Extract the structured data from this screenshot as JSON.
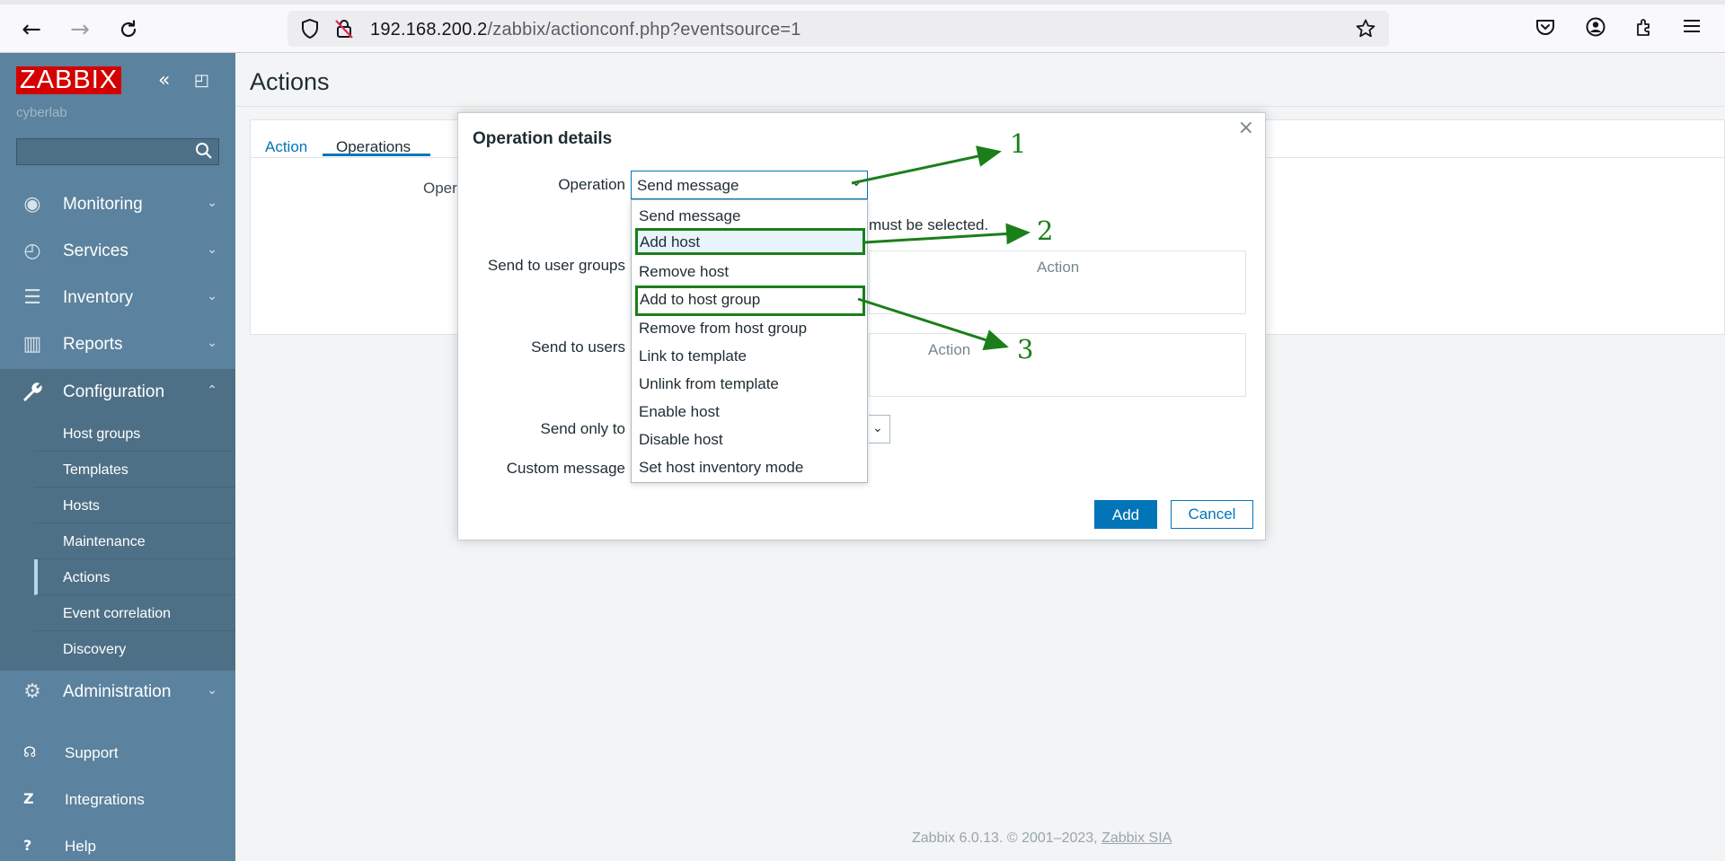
{
  "browser": {
    "url_host": "192.168.200.2",
    "url_path": "/zabbix/actionconf.php?eventsource=1",
    "back_glyph": "←",
    "forward_glyph": "→",
    "reload_glyph": "C",
    "icons": [
      "back-icon",
      "forward-icon",
      "reload-icon",
      "shield-icon",
      "insecure-lock-icon",
      "star-icon",
      "pocket-icon",
      "account-icon",
      "extensions-icon",
      "menu-icon"
    ]
  },
  "sidebar": {
    "logo": "ZABBIX",
    "tenant": "cyberlab",
    "collapse_glyph": "«",
    "kiosk_glyph": "◰",
    "search_placeholder": "",
    "menu": [
      {
        "label": "Monitoring",
        "icon": "eye-icon",
        "glyph": "◉",
        "arrow": "⌄"
      },
      {
        "label": "Services",
        "icon": "timer-icon",
        "glyph": "◴",
        "arrow": "⌄"
      },
      {
        "label": "Inventory",
        "icon": "list-icon",
        "glyph": "☰",
        "arrow": "⌄"
      },
      {
        "label": "Reports",
        "icon": "bar-chart-icon",
        "glyph": "▥",
        "arrow": "⌄"
      },
      {
        "label": "Configuration",
        "icon": "wrench-icon",
        "glyph": "🔧",
        "arrow": "⌃"
      }
    ],
    "submenu": [
      {
        "label": "Host groups"
      },
      {
        "label": "Templates"
      },
      {
        "label": "Hosts"
      },
      {
        "label": "Maintenance"
      },
      {
        "label": "Actions",
        "arrow": "›"
      },
      {
        "label": "Event correlation"
      },
      {
        "label": "Discovery"
      }
    ],
    "administration": {
      "label": "Administration",
      "icon": "gear-icon",
      "glyph": "⚙",
      "arrow": "⌄"
    },
    "bottom": [
      {
        "label": "Support",
        "icon": "headset-icon",
        "glyph": "☊"
      },
      {
        "label": "Integrations",
        "icon": "z-icon",
        "glyph": "Z"
      },
      {
        "label": "Help",
        "icon": "question-icon",
        "glyph": "?"
      }
    ]
  },
  "page": {
    "title": "Actions",
    "tabs": [
      "Action",
      "Operations"
    ],
    "active_tab": "Operations",
    "bg_label_fragment": "Oper"
  },
  "modal": {
    "title": "Operation details",
    "close_glyph": "×",
    "operation_label": "Operation",
    "operation_value": "Send message",
    "warning_fragment": "must be selected.",
    "send_to_user_groups_label": "Send to user groups",
    "send_to_users_label": "Send to users",
    "table_action_header": "Action",
    "send_only_to_label": "Send only to",
    "custom_message_label": "Custom message",
    "add_button": "Add",
    "cancel_button": "Cancel",
    "dropdown_options": [
      "Send message",
      "Add host",
      "Remove host",
      "Add to host group",
      "Remove from host group",
      "Link to template",
      "Unlink from template",
      "Enable host",
      "Disable host",
      "Set host inventory mode"
    ]
  },
  "annotations": {
    "color": "#1a7f1a",
    "labels": [
      "1",
      "2",
      "3"
    ]
  },
  "footer": {
    "text": "Zabbix 6.0.13. © 2001–2023, ",
    "link": "Zabbix SIA"
  }
}
